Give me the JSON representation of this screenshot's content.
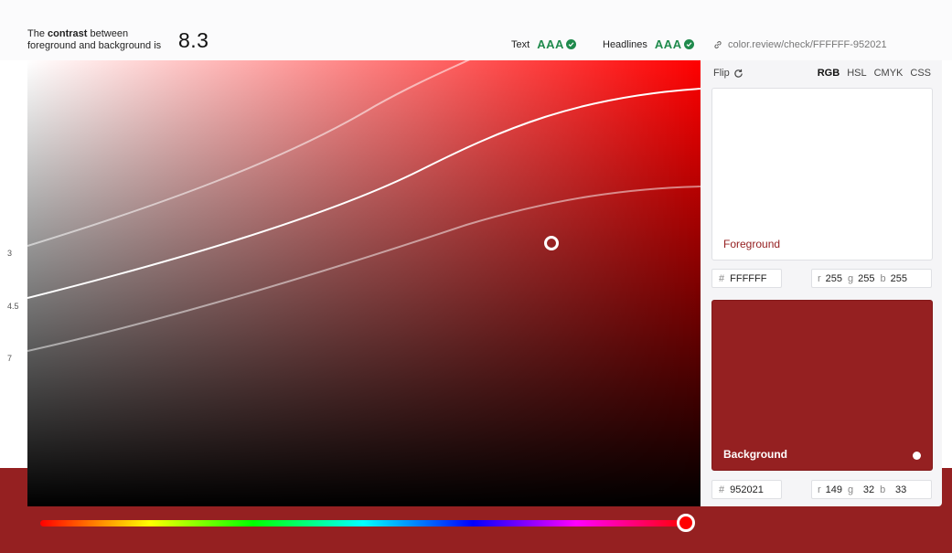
{
  "header": {
    "contrast_prefix": "The ",
    "contrast_bold": "contrast",
    "contrast_mid": " between",
    "contrast_line2": "foreground and background is",
    "ratio": "8.3",
    "text_label": "Text",
    "text_score": "AAA",
    "headlines_label": "Headlines",
    "headlines_score": "AAA",
    "link": "color.review/check/FFFFFF-952021"
  },
  "axis_labels": [
    "3",
    "4.5",
    "7"
  ],
  "panel": {
    "flip_label": "Flip",
    "models": [
      "RGB",
      "HSL",
      "CMYK",
      "CSS"
    ],
    "foreground": {
      "label": "Foreground",
      "hex": "FFFFFF",
      "r": "255",
      "g": "255",
      "b": "255",
      "color": "#ffffff"
    },
    "background": {
      "label": "Background",
      "hex": "952021",
      "r": "149",
      "g": "32",
      "b": "33",
      "color": "#952021"
    },
    "hex_prefix": "#",
    "r_key": "r",
    "g_key": "g",
    "b_key": "b"
  },
  "hue": {
    "value_fraction": 1.0
  },
  "colors": {
    "accent_red": "#952021",
    "pass_green": "#1f8a4c"
  }
}
